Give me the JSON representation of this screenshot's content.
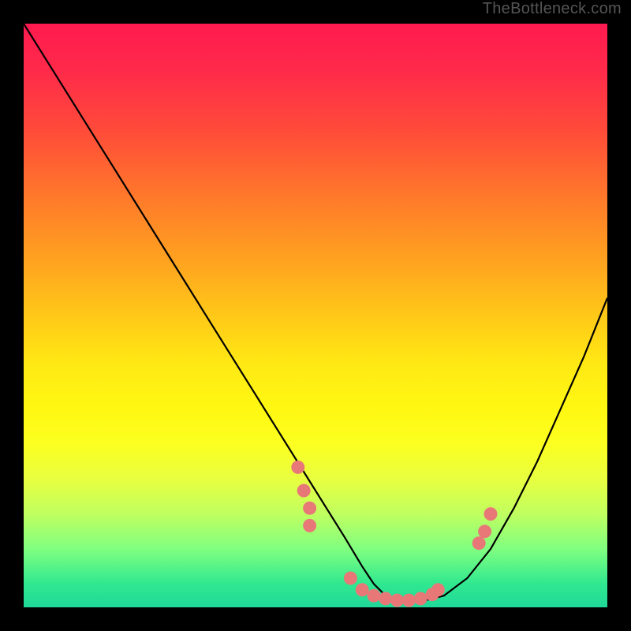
{
  "watermark": "TheBottleneck.com",
  "chart_data": {
    "type": "line",
    "title": "",
    "xlabel": "",
    "ylabel": "",
    "xlim": [
      0,
      100
    ],
    "ylim": [
      0,
      100
    ],
    "curve": {
      "name": "bottleneck-curve",
      "x": [
        0,
        5,
        10,
        15,
        20,
        25,
        30,
        35,
        40,
        45,
        50,
        55,
        58,
        60,
        62,
        65,
        68,
        72,
        76,
        80,
        84,
        88,
        92,
        96,
        100
      ],
      "y": [
        100,
        92,
        84,
        76,
        68,
        60,
        52,
        44,
        36,
        28,
        20,
        12,
        7,
        4,
        2,
        1,
        1,
        2,
        5,
        10,
        17,
        25,
        34,
        43,
        53
      ]
    },
    "markers": {
      "name": "highlight-points",
      "color": "#e87878",
      "x": [
        47,
        48,
        49,
        49,
        56,
        58,
        60,
        62,
        64,
        66,
        68,
        70,
        71,
        78,
        79,
        80
      ],
      "y": [
        24,
        20,
        17,
        14,
        5,
        3,
        2,
        1.5,
        1.2,
        1.2,
        1.5,
        2.2,
        3,
        11,
        13,
        16
      ]
    },
    "gradient_stops": [
      {
        "pct": 0,
        "color": "#ff1a4f"
      },
      {
        "pct": 50,
        "color": "#ffe814"
      },
      {
        "pct": 100,
        "color": "#20d898"
      }
    ]
  }
}
